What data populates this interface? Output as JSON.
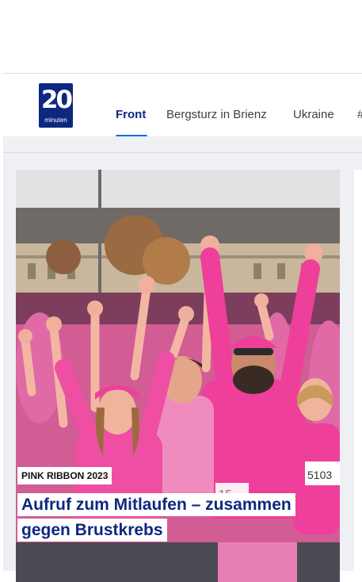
{
  "logo": {
    "number": "20",
    "word": "minuten"
  },
  "nav": {
    "items": [
      {
        "label": "Front",
        "active": true
      },
      {
        "label": "Bergsturz in Brienz",
        "active": false
      },
      {
        "label": "Ukraine",
        "active": false
      },
      {
        "label": "#",
        "active": false
      }
    ]
  },
  "article": {
    "kicker": "PINK RIBBON 2023",
    "headline_line1": "Aufruf zum Mitlaufen – zusammen",
    "headline_line2": "gegen Brustkrebs",
    "photo_numbers": [
      "15",
      "5103"
    ]
  },
  "colors": {
    "brand": "#0d2880",
    "accent_underline": "#0d69e8",
    "shirt_pink": "#ee3f9a",
    "background": "#eef0f4"
  }
}
